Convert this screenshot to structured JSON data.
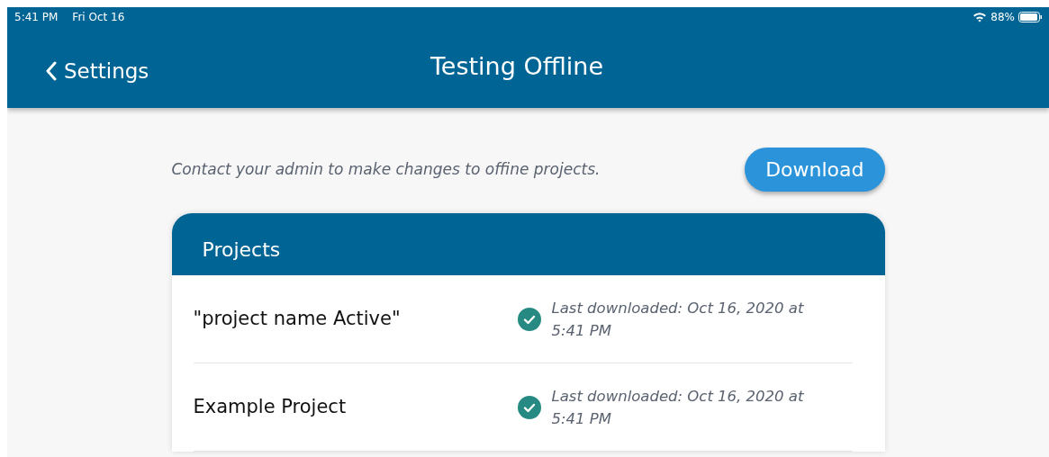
{
  "status_bar": {
    "time": "5:41 PM",
    "date": "Fri Oct 16",
    "battery": "88%"
  },
  "nav_bar": {
    "back_label": "Settings",
    "title": "Testing Offline"
  },
  "notice": "Contact your admin to make changes to offine projects.",
  "download_button": "Download",
  "projects": {
    "title": "Projects",
    "rows": [
      {
        "name": "\"project name Active\"",
        "synced": true,
        "status": "Last downloaded: Oct 16, 2020 at 5:41 PM"
      },
      {
        "name": "Example Project",
        "synced": true,
        "status": "Last downloaded: Oct 16, 2020 at 5:41 PM"
      }
    ]
  }
}
